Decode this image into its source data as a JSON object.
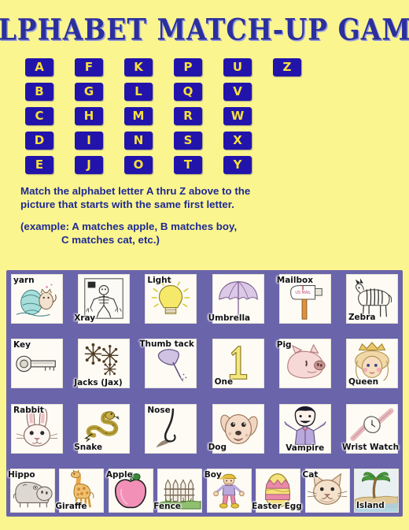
{
  "page": {
    "title": "ALPHABET MATCH-UP GAME",
    "background_color": "#fbf58f",
    "panel_color": "#6a64ab",
    "tile_color": "#2214ab",
    "tile_text_color": "#f5e03c",
    "title_color": "#2b2f9e"
  },
  "alphabet": {
    "columns": [
      [
        "A",
        "B",
        "C",
        "D",
        "E"
      ],
      [
        "F",
        "G",
        "H",
        "I",
        "J"
      ],
      [
        "K",
        "L",
        "M",
        "N",
        "O"
      ],
      [
        "P",
        "Q",
        "R",
        "S",
        "T"
      ],
      [
        "U",
        "V",
        "W",
        "X",
        "Y"
      ],
      [
        "Z"
      ]
    ]
  },
  "instructions": {
    "line1": "Match the alphabet letter A thru Z above to the",
    "line2": "picture that starts with the same first letter.",
    "line3": "(example: A matches apple, B matches boy,",
    "line4": "C matches cat, etc.)"
  },
  "pictures": {
    "rows": [
      [
        {
          "label": "yarn",
          "icon": "yarn-ball-icon",
          "pos": "tl"
        },
        {
          "label": "Xray",
          "icon": "xray-skeleton-icon",
          "pos": "bl-out"
        },
        {
          "label": "Light",
          "icon": "lightbulb-icon",
          "pos": "tl"
        },
        {
          "label": "Umbrella",
          "icon": "umbrella-icon",
          "pos": "bl-out"
        },
        {
          "label": "Mailbox",
          "icon": "mailbox-icon",
          "pos": "tl-out"
        },
        {
          "label": "Zebra",
          "icon": "zebra-icon",
          "pos": "bl"
        }
      ],
      [
        {
          "label": "Key",
          "icon": "key-icon",
          "pos": "tl"
        },
        {
          "label": "Jacks (Jax)",
          "icon": "jacks-icon",
          "pos": "bl-out"
        },
        {
          "label": "Thumb tack",
          "icon": "thumbtack-icon",
          "pos": "tl-neg"
        },
        {
          "label": "One",
          "icon": "number-one-icon",
          "pos": "bl"
        },
        {
          "label": "Pig",
          "icon": "pig-icon",
          "pos": "tl-out"
        },
        {
          "label": "Queen",
          "icon": "queen-icon",
          "pos": "bl"
        }
      ],
      [
        {
          "label": "Rabbit",
          "icon": "rabbit-icon",
          "pos": "tl"
        },
        {
          "label": "Snake",
          "icon": "snake-icon",
          "pos": "bl-out"
        },
        {
          "label": "Nose",
          "icon": "nose-icon",
          "pos": "tl"
        },
        {
          "label": "Dog",
          "icon": "dog-icon",
          "pos": "bl-out"
        },
        {
          "label": "Vampire",
          "icon": "vampire-icon",
          "pos": "bc-out"
        },
        {
          "label": "Wrist Watch",
          "icon": "wristwatch-icon",
          "pos": "bl-out"
        }
      ],
      [
        {
          "label": "Hippo",
          "icon": "hippo-icon",
          "pos": "tl-out"
        },
        {
          "label": "Giraffe",
          "icon": "giraffe-icon",
          "pos": "bl-out"
        },
        {
          "label": "Apple",
          "icon": "apple-icon",
          "pos": "tl-out"
        },
        {
          "label": "Fence",
          "icon": "fence-icon",
          "pos": "bl-out"
        },
        {
          "label": "Boy",
          "icon": "boy-icon",
          "pos": "tl-out"
        },
        {
          "label": "Easter Egg",
          "icon": "easter-egg-icon",
          "pos": "bl-out"
        },
        {
          "label": "Cat",
          "icon": "cat-icon",
          "pos": "tl-out"
        },
        {
          "label": "Island",
          "icon": "island-palm-icon",
          "pos": "bl"
        }
      ]
    ],
    "mailbox_text": "US MAIL"
  }
}
